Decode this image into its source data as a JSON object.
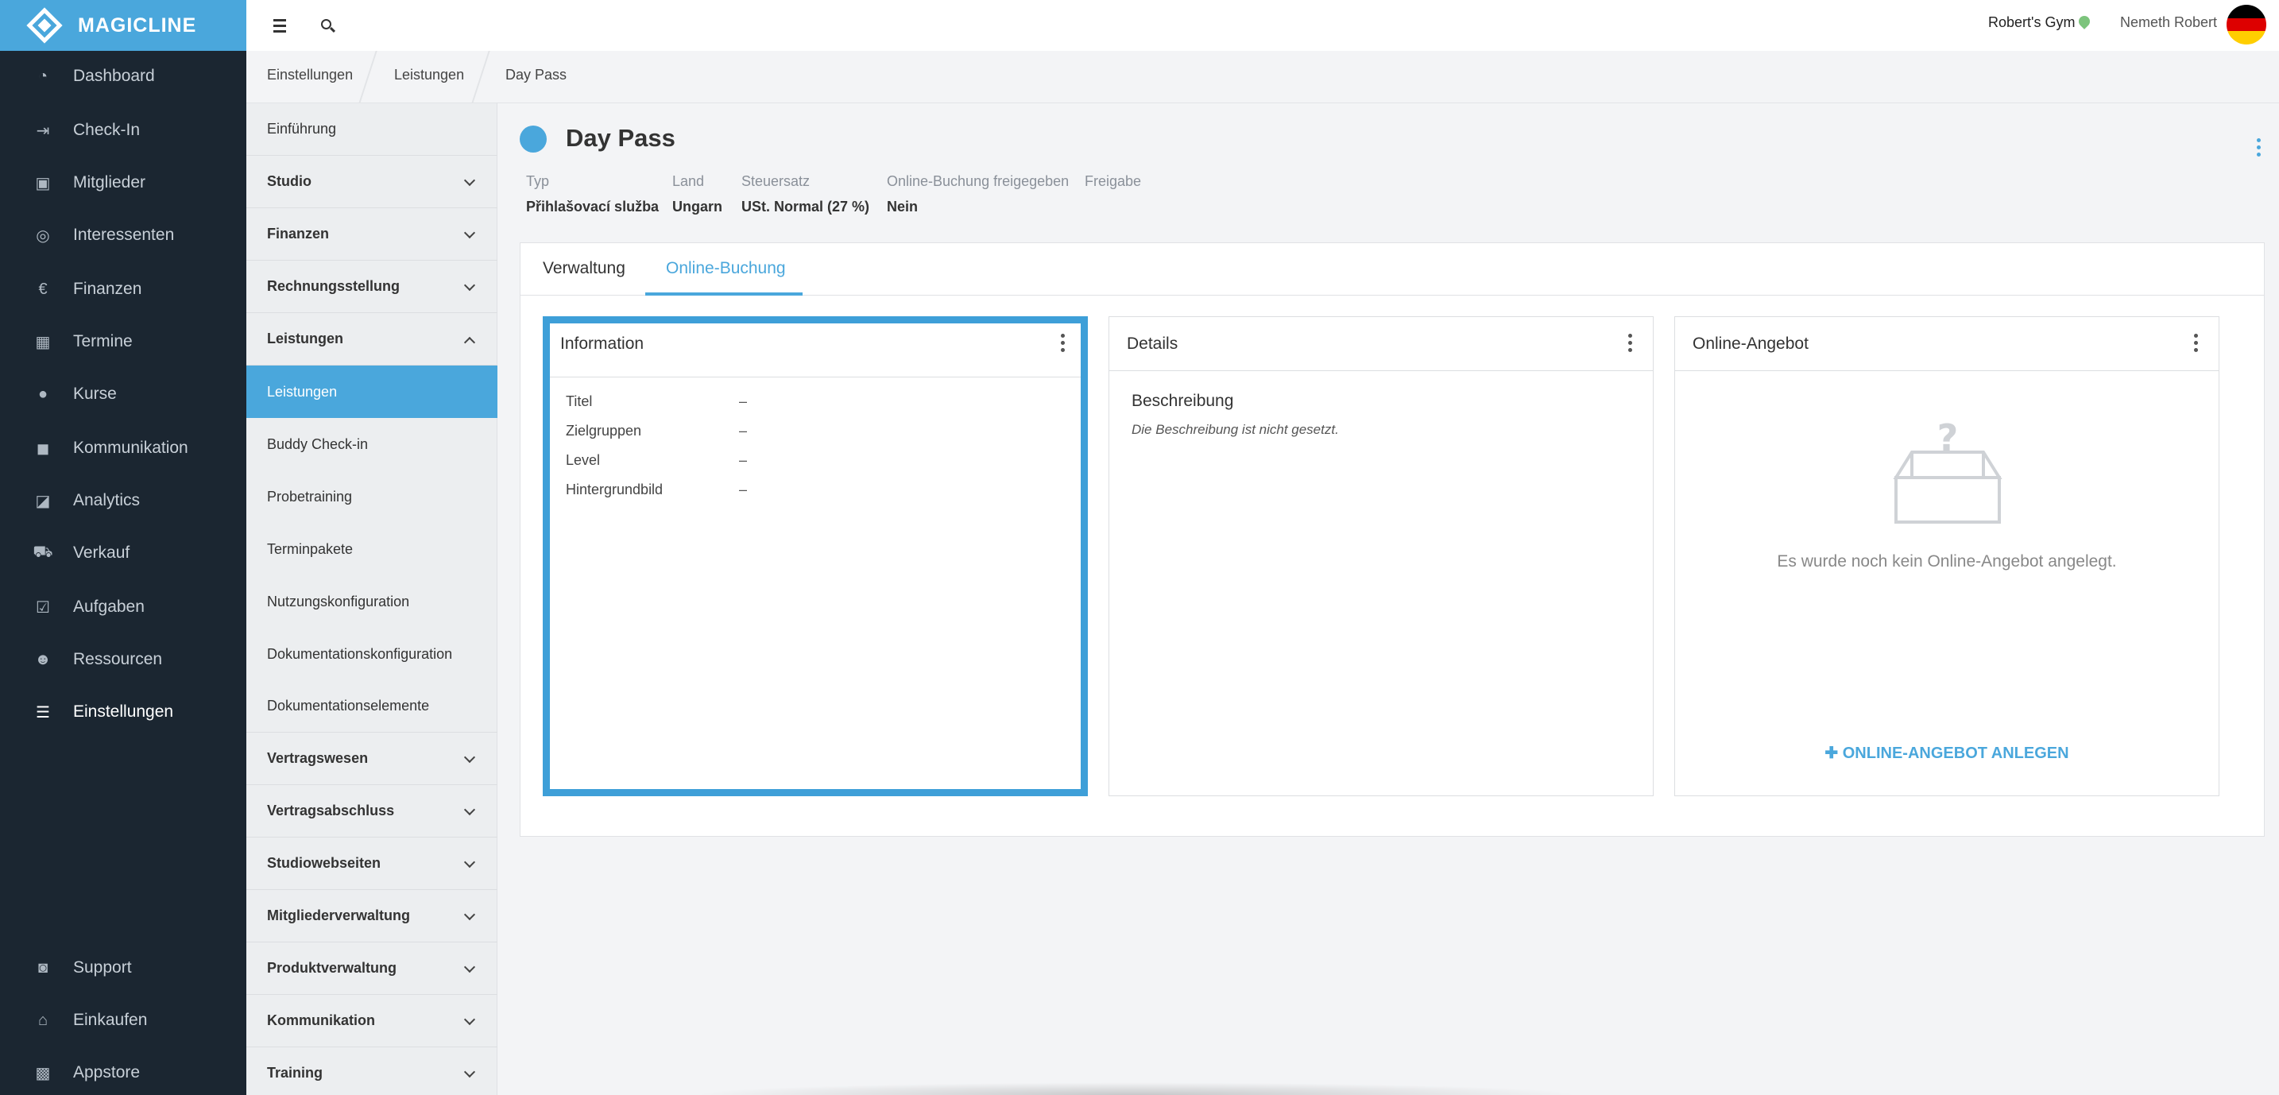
{
  "brand": {
    "name": "MAGICLINE"
  },
  "leftnav": {
    "items": [
      {
        "label": "Dashboard",
        "icon": "dashboard-icon"
      },
      {
        "label": "Check-In",
        "icon": "check-in-icon"
      },
      {
        "label": "Mitglieder",
        "icon": "members-icon"
      },
      {
        "label": "Interessenten",
        "icon": "prospects-icon"
      },
      {
        "label": "Finanzen",
        "icon": "euro-icon"
      },
      {
        "label": "Termine",
        "icon": "calendar-icon"
      },
      {
        "label": "Kurse",
        "icon": "courses-icon"
      },
      {
        "label": "Kommunikation",
        "icon": "chat-icon"
      },
      {
        "label": "Analytics",
        "icon": "chart-icon"
      },
      {
        "label": "Verkauf",
        "icon": "cart-icon"
      },
      {
        "label": "Aufgaben",
        "icon": "checkbox-icon"
      },
      {
        "label": "Ressourcen",
        "icon": "people-icon"
      },
      {
        "label": "Einstellungen",
        "icon": "sliders-icon"
      }
    ],
    "bottom_items": [
      {
        "label": "Support",
        "icon": "support-icon"
      },
      {
        "label": "Einkaufen",
        "icon": "shop-icon"
      },
      {
        "label": "Appstore",
        "icon": "apps-icon"
      }
    ]
  },
  "topbar": {
    "gym_name": "Robert's Gym",
    "user_name": "Nemeth Robert",
    "flag_colors": [
      "#000000",
      "#dd0000",
      "#ffce00"
    ]
  },
  "breadcrumb": [
    "Einstellungen",
    "Leistungen",
    "Day Pass"
  ],
  "settings_menu": {
    "items": [
      {
        "label": "Einführung"
      },
      {
        "label": "Studio"
      },
      {
        "label": "Finanzen"
      },
      {
        "label": "Rechnungsstellung"
      },
      {
        "label": "Leistungen"
      },
      {
        "label": "Leistungen"
      },
      {
        "label": "Buddy Check-in"
      },
      {
        "label": "Probetraining"
      },
      {
        "label": "Terminpakete"
      },
      {
        "label": "Nutzungskonfiguration"
      },
      {
        "label": "Dokumentationskonfiguration"
      },
      {
        "label": "Dokumentationselemente"
      },
      {
        "label": "Vertragswesen"
      },
      {
        "label": "Vertragsabschluss"
      },
      {
        "label": "Studiowebseiten"
      },
      {
        "label": "Mitgliederverwaltung"
      },
      {
        "label": "Produktverwaltung"
      },
      {
        "label": "Kommunikation"
      },
      {
        "label": "Training"
      }
    ]
  },
  "page": {
    "title": "Day Pass",
    "status_color": "#4aa7dc",
    "meta": [
      {
        "label": "Typ",
        "value": "Přihlašovací služba"
      },
      {
        "label": "Land",
        "value": "Ungarn"
      },
      {
        "label": "Steuersatz",
        "value": "USt. Normal (27 %)"
      },
      {
        "label": "Online-Buchung freigegeben",
        "value": "Nein"
      },
      {
        "label": "Freigabe",
        "value": ""
      }
    ],
    "tabs": [
      {
        "label": "Verwaltung"
      },
      {
        "label": "Online-Buchung"
      }
    ]
  },
  "cards": {
    "information": {
      "title": "Information",
      "rows": [
        {
          "label": "Titel",
          "value": "–"
        },
        {
          "label": "Zielgruppen",
          "value": "–"
        },
        {
          "label": "Level",
          "value": "–"
        },
        {
          "label": "Hintergrundbild",
          "value": "–"
        }
      ]
    },
    "details": {
      "title": "Details",
      "description_heading": "Beschreibung",
      "description_text": "Die Beschreibung ist nicht gesetzt."
    },
    "online_offer": {
      "title": "Online-Angebot",
      "empty_text": "Es wurde noch kein Online-Angebot angelegt.",
      "create_label": "ONLINE-ANGEBOT ANLEGEN"
    }
  },
  "colors": {
    "accent": "#4aa7dc",
    "sidebar": "#1b2631"
  }
}
